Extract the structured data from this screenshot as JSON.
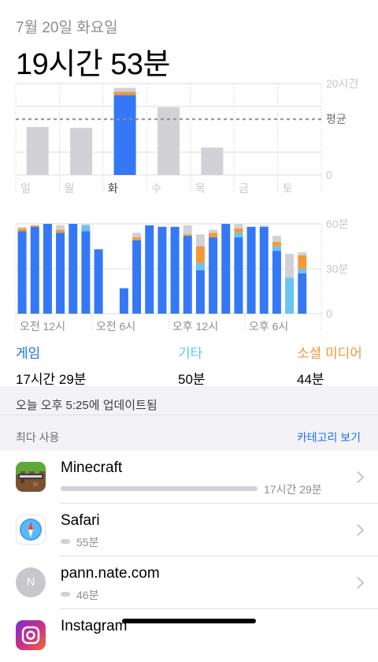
{
  "header": {
    "date": "7월 20일 화요일",
    "total_time": "19시간 53분"
  },
  "colors": {
    "blue": "#3478f6",
    "light_blue": "#6ac4f2",
    "orange": "#f19a37",
    "gray": "#d1d1d6",
    "grid": "#dddddd"
  },
  "weekly_chart": {
    "days": [
      "일",
      "월",
      "화",
      "수",
      "목",
      "금",
      "토"
    ],
    "y_labels": {
      "max": "20시간",
      "avg": "평균",
      "zero": "0"
    },
    "max_hours": 20,
    "avg_hours": 12.2,
    "today_index": 2,
    "values_hours": [
      10.5,
      10.3,
      19.9,
      14.8,
      6.0,
      0,
      0
    ],
    "today_breakdown": {
      "game": 17.48,
      "social": 0.73,
      "other": 0.83
    }
  },
  "hourly_chart": {
    "x_labels": [
      "오전 12시",
      "오전 6시",
      "오후 12시",
      "오후 6시"
    ],
    "y_labels": [
      "60분",
      "30분",
      "0"
    ],
    "max_minutes": 60,
    "hours": [
      {
        "game": 55,
        "light": 0,
        "orange": 2,
        "gray": 1
      },
      {
        "game": 58,
        "light": 0,
        "orange": 1,
        "gray": 0
      },
      {
        "game": 60,
        "light": 0,
        "orange": 0,
        "gray": 0
      },
      {
        "game": 54,
        "light": 0,
        "orange": 2,
        "gray": 3
      },
      {
        "game": 60,
        "light": 0,
        "orange": 0,
        "gray": 0
      },
      {
        "game": 55,
        "light": 4,
        "orange": 0,
        "gray": 1
      },
      {
        "game": 43,
        "light": 0,
        "orange": 0,
        "gray": 0
      },
      {
        "game": 0,
        "light": 0,
        "orange": 0,
        "gray": 0
      },
      {
        "game": 17,
        "light": 0,
        "orange": 0,
        "gray": 0
      },
      {
        "game": 49,
        "light": 0,
        "orange": 2,
        "gray": 3
      },
      {
        "game": 59,
        "light": 0,
        "orange": 0,
        "gray": 0
      },
      {
        "game": 58,
        "light": 0,
        "orange": 0,
        "gray": 0
      },
      {
        "game": 58,
        "light": 0,
        "orange": 0,
        "gray": 0
      },
      {
        "game": 52,
        "light": 0,
        "orange": 1,
        "gray": 6
      },
      {
        "game": 29,
        "light": 5,
        "orange": 11,
        "gray": 8
      },
      {
        "game": 51,
        "light": 0,
        "orange": 3,
        "gray": 2
      },
      {
        "game": 60,
        "light": 0,
        "orange": 0,
        "gray": 0
      },
      {
        "game": 51,
        "light": 3,
        "orange": 3,
        "gray": 3
      },
      {
        "game": 58,
        "light": 0,
        "orange": 0,
        "gray": 0
      },
      {
        "game": 58,
        "light": 0,
        "orange": 0,
        "gray": 1
      },
      {
        "game": 42,
        "light": 3,
        "orange": 3,
        "gray": 4
      },
      {
        "game": 0,
        "light": 24,
        "orange": 0,
        "gray": 16
      },
      {
        "game": 27,
        "light": 3,
        "orange": 9,
        "gray": 2
      }
    ]
  },
  "categories": [
    {
      "name": "게임",
      "time": "17시간 29분",
      "color": "#1a73e8"
    },
    {
      "name": "기타",
      "time": "50분",
      "color": "#5ac8fa"
    },
    {
      "name": "소셜 미디어",
      "time": "44분",
      "color": "#f19a37"
    }
  ],
  "updated_text": "오늘 오후 5:25에 업데이트됨",
  "most_used": {
    "label": "최다 사용",
    "link": "카테고리 보기",
    "apps": [
      {
        "name": "Minecraft",
        "time": "17시간 29분",
        "bar_fraction": 1.0,
        "icon": "minecraft-icon"
      },
      {
        "name": "Safari",
        "time": "55분",
        "bar_fraction": 0.05,
        "icon": "safari-compass-icon"
      },
      {
        "name": "pann.nate.com",
        "time": "46분",
        "bar_fraction": 0.04,
        "icon": "letter-n-icon",
        "icon_letter": "N"
      },
      {
        "name": "Instagram",
        "time": "",
        "bar_fraction": 0,
        "icon": "instagram-icon"
      }
    ]
  }
}
